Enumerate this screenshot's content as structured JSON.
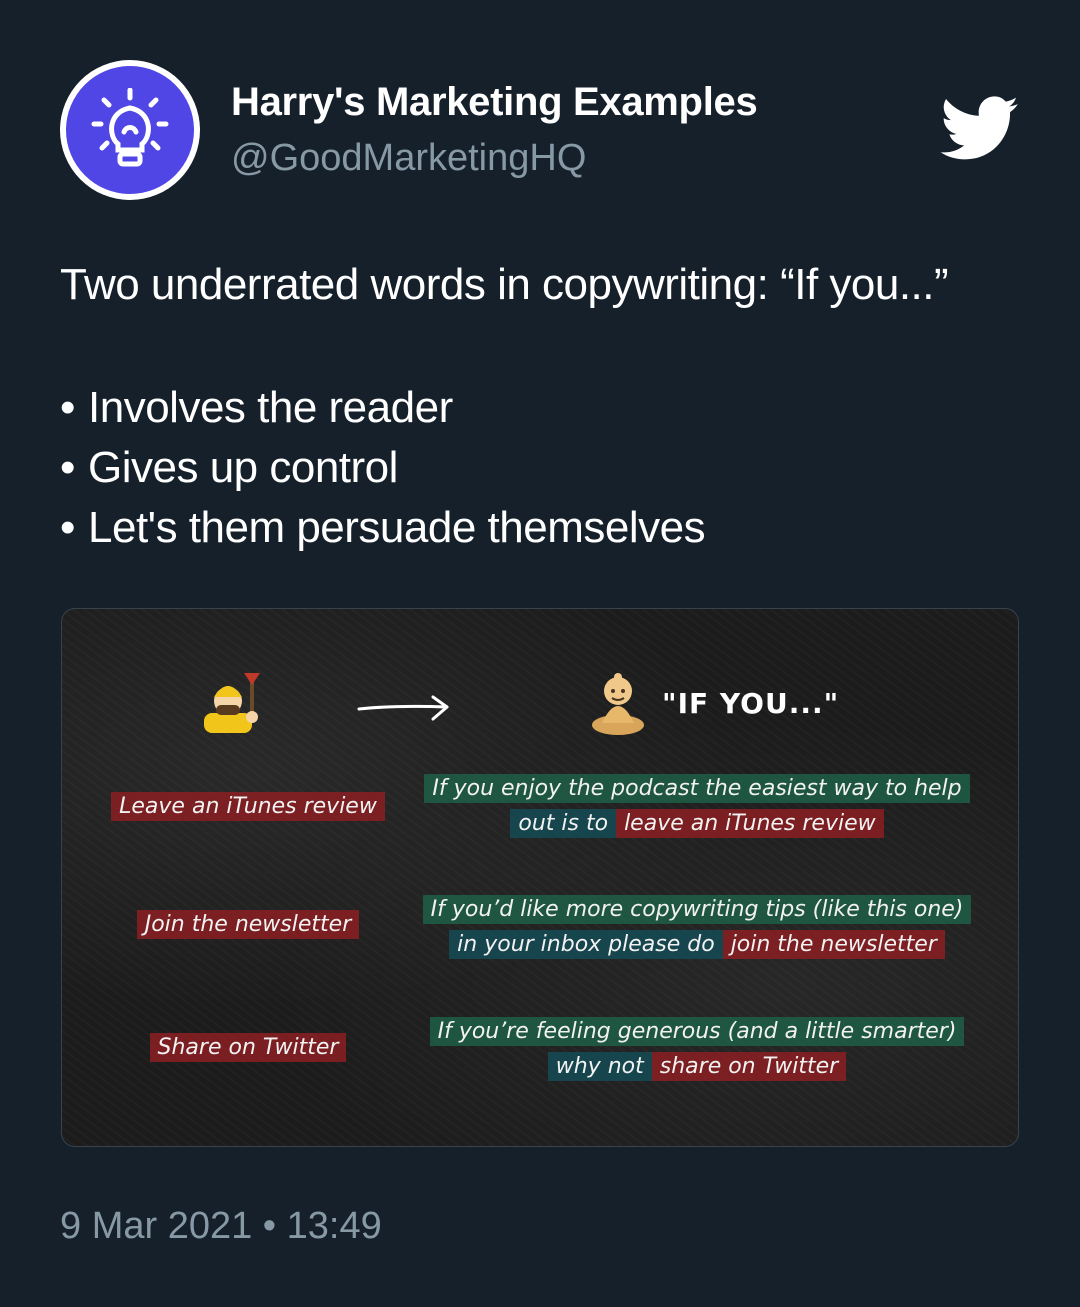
{
  "author": {
    "display_name": "Harry's Marketing Examples",
    "handle": "@GoodMarketingHQ"
  },
  "tweet": {
    "headline": "Two underrated words in copywriting: “If you...”",
    "bullet_char": "•",
    "bullets": [
      "Involves the reader",
      "Gives up control",
      "Let's them persuade themselves"
    ],
    "timestamp": "9 Mar 2021 • 13:49"
  },
  "media": {
    "if_you_label": "\"IF YOU...\"",
    "rows": [
      {
        "left": "Leave an iTunes review",
        "right_line1": "If you enjoy the podcast the easiest way to help",
        "right_line2_a": "out is to",
        "right_line2_b": "leave an iTunes review"
      },
      {
        "left": "Join the newsletter",
        "right_line1": "If you’d like more copywriting tips (like this one)",
        "right_line2_a": "in your inbox please do",
        "right_line2_b": "join the newsletter"
      },
      {
        "left": "Share on Twitter",
        "right_line1": "If you’re feeling generous (and a little smarter)",
        "right_line2_a": "why not",
        "right_line2_b": "share on Twitter"
      }
    ]
  },
  "colors": {
    "background": "#15202b",
    "secondary_text": "#8899a6",
    "avatar": "#4f46e5",
    "highlight_red": "#8c1e22",
    "highlight_green": "#1e5f46",
    "highlight_teal": "#144b55"
  },
  "icons": [
    "lightbulb-icon",
    "twitter-bird-icon",
    "worker-icon",
    "arrow-right-icon",
    "meditating-monk-icon"
  ]
}
